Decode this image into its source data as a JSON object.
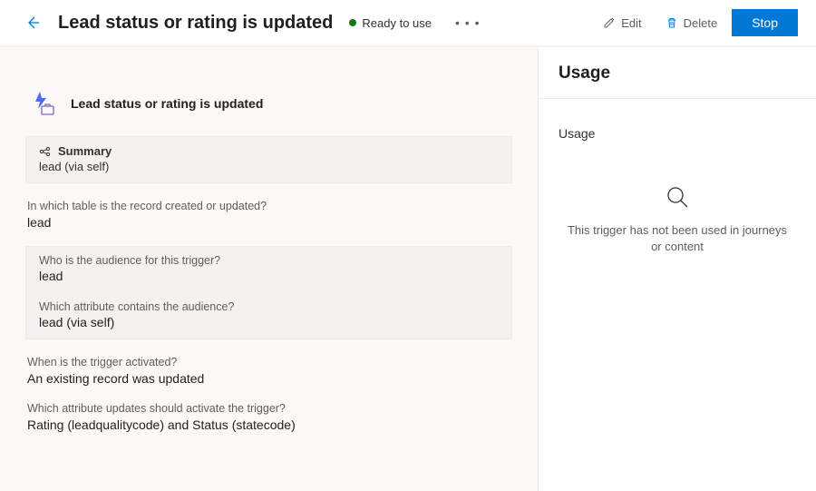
{
  "header": {
    "title": "Lead status or rating is updated",
    "status_label": "Ready to use",
    "edit_label": "Edit",
    "delete_label": "Delete",
    "stop_label": "Stop"
  },
  "main": {
    "trigger_title": "Lead status or rating is updated",
    "summary": {
      "label": "Summary",
      "value": "lead (via self)"
    },
    "table_question": "In which table is the record created or updated?",
    "table_value": "lead",
    "audience_question": "Who is the audience for this trigger?",
    "audience_value": "lead",
    "attribute_question": "Which attribute contains the audience?",
    "attribute_value": "lead (via self)",
    "when_question": "When is the trigger activated?",
    "when_value": "An existing record was updated",
    "updates_question": "Which attribute updates should activate the trigger?",
    "updates_value": "Rating (leadqualitycode) and Status (statecode)"
  },
  "side": {
    "title": "Usage",
    "subtitle": "Usage",
    "empty_text": "This trigger has not been used in journeys or content"
  }
}
